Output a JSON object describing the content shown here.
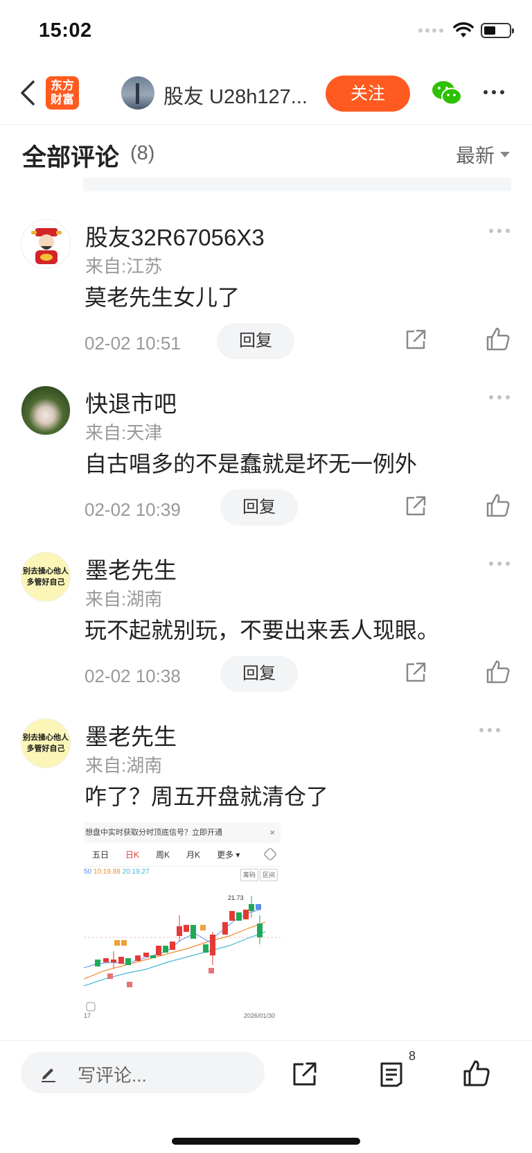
{
  "status_bar": {
    "time": "15:02"
  },
  "nav": {
    "logo_line1": "东方",
    "logo_line2": "财富",
    "username": "股友 U28h127...",
    "follow_label": "关注"
  },
  "comments_header": {
    "title": "全部评论",
    "count": "(8)",
    "sort_label": "最新"
  },
  "comments": [
    {
      "name": "股友32R67056X3",
      "location": "来自:江苏",
      "text": "莫老先生女儿了",
      "time": "02-02 10:51",
      "reply_label": "回复",
      "avatar": "caishen-avatar"
    },
    {
      "name": "快退市吧",
      "location": "来自:天津",
      "text": "自古唱多的不是蠢就是坏无一例外",
      "time": "02-02 10:39",
      "reply_label": "回复",
      "avatar": "rabbit-photo-avatar"
    },
    {
      "name": "墨老先生",
      "location": "来自:湖南",
      "text": "玩不起就别玩，不要出来丢人现眼。",
      "time": "02-02 10:38",
      "reply_label": "回复",
      "avatar": "yellow-text-avatar",
      "avatar_line1": "别去操心他人",
      "avatar_line2": "多管好自己"
    },
    {
      "name": "墨老先生",
      "location": "来自:湖南",
      "text": "咋了？周五开盘就清仓了",
      "avatar": "yellow-text-avatar",
      "avatar_line1": "别去操心他人",
      "avatar_line2": "多管好自己"
    }
  ],
  "chart_image": {
    "ad_text": "想盘中实时获取分时顶底信号？立即开通",
    "tabs": [
      "五日",
      "日K",
      "周K",
      "月K",
      "更多"
    ],
    "active_tab": "日K",
    "ma_labels": [
      "50",
      "10:19.88",
      "20:19.27"
    ],
    "chip_labels": [
      "筹码",
      "区间"
    ],
    "peak_label": "21.73",
    "date_left": "17",
    "date_right": "2026/01/30"
  },
  "bottom_bar": {
    "write_placeholder": "写评论...",
    "comment_count": "8"
  },
  "colors": {
    "brand": "#ff5a1f",
    "rise": "#e53935",
    "fall": "#1faa59"
  }
}
